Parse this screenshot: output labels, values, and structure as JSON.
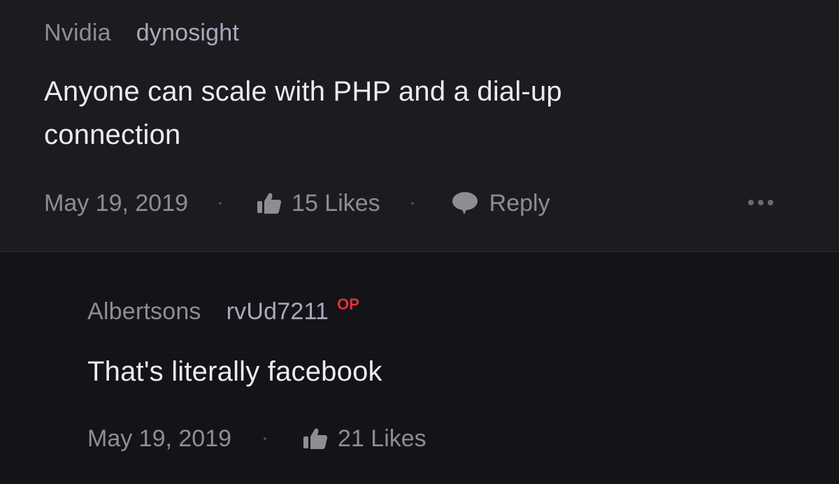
{
  "comments": [
    {
      "company": "Nvidia",
      "username": "dynosight",
      "badge": "",
      "text": "Anyone can scale with PHP and a dial-up connection",
      "date": "May 19, 2019",
      "likes": "15 Likes",
      "reply_label": "Reply"
    },
    {
      "company": "Albertsons",
      "username": "rvUd7211",
      "badge": "OP",
      "text": "That's literally facebook",
      "date": "May 19, 2019",
      "likes": "21 Likes"
    }
  ],
  "colors": {
    "background": "#141418",
    "top_comment_bg": "#1c1c20",
    "op_badge": "#e0303a"
  },
  "icons": [
    "thumbs-up-icon",
    "speech-bubble-icon",
    "more-dots-icon"
  ]
}
